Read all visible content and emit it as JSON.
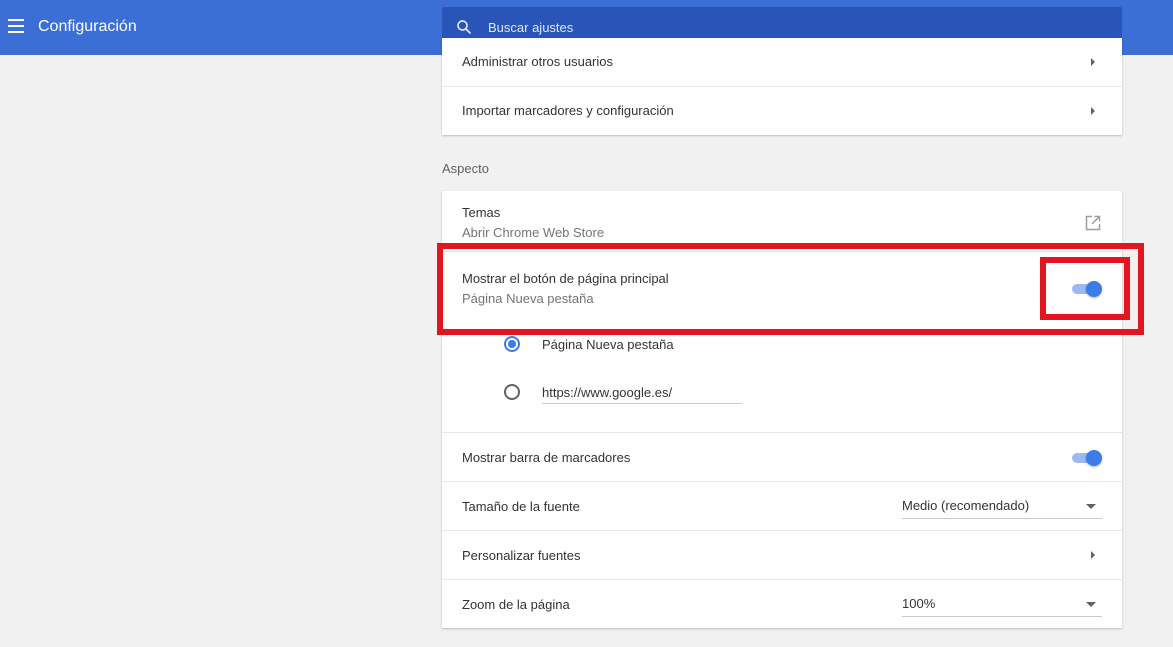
{
  "header": {
    "title": "Configuración",
    "search_placeholder": "Buscar ajustes"
  },
  "people_card": {
    "manage_users": "Administrar otros usuarios",
    "import_bookmarks": "Importar marcadores y configuración"
  },
  "appearance": {
    "section_title": "Aspecto",
    "themes": {
      "label": "Temas",
      "sublabel": "Abrir Chrome Web Store"
    },
    "home_button": {
      "label": "Mostrar el botón de página principal",
      "sublabel": "Página Nueva pestaña",
      "enabled": true
    },
    "home_options": {
      "new_tab_label": "Página Nueva pestaña",
      "custom_url_value": "https://www.google.es/",
      "selected": "new_tab"
    },
    "bookmarks_bar": {
      "label": "Mostrar barra de marcadores",
      "enabled": true
    },
    "font_size": {
      "label": "Tamaño de la fuente",
      "value": "Medio (recomendado)"
    },
    "customize_fonts": {
      "label": "Personalizar fuentes"
    },
    "page_zoom": {
      "label": "Zoom de la página",
      "value": "100%"
    }
  },
  "colors": {
    "header_bg": "#3b6fd6",
    "search_bg": "#2a55b8",
    "accent": "#3b7de8",
    "highlight": "#e3161f"
  }
}
